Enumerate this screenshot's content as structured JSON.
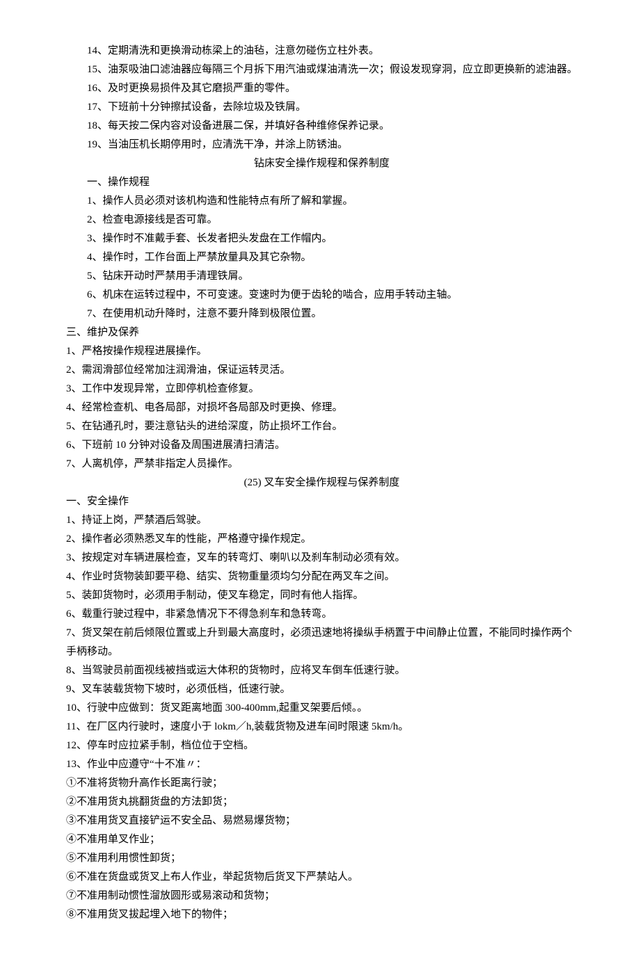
{
  "lines": [
    {
      "cls": "indent",
      "t": "14、定期清洗和更换滑动栋梁上的油毡，注意勿碰伤立柱外表。"
    },
    {
      "cls": "indent",
      "t": "15、油泵吸油口滤油器应每隔三个月拆下用汽油或煤油清洗一次；假设发现穿洞，应立即更换新的滤油器。"
    },
    {
      "cls": "indent",
      "t": "16、及时更换易损件及其它磨损严重的零件。"
    },
    {
      "cls": "indent",
      "t": "17、下班前十分钟擦拭设备，去除垃圾及铁屑。"
    },
    {
      "cls": "indent",
      "t": "18、每天按二保内容对设备进展二保，并填好各种维修保养记录。"
    },
    {
      "cls": "indent",
      "t": "19、当油压机长期停用时，应清洗干净，并涂上防锈油。"
    },
    {
      "cls": "center",
      "t": "钻床安全操作规程和保养制度"
    },
    {
      "cls": "indent",
      "t": "一、操作规程"
    },
    {
      "cls": "indent",
      "t": "1、操作人员必须对该机构造和性能特点有所了解和掌握。"
    },
    {
      "cls": "indent",
      "t": "2、检查电源接线是否可靠。"
    },
    {
      "cls": "indent",
      "t": "3、操作时不准戴手套、长发者把头发盘在工作帽内。"
    },
    {
      "cls": "indent",
      "t": "4、操作时，工作台面上严禁放量具及其它杂物。"
    },
    {
      "cls": "indent",
      "t": "5、钻床开动时严禁用手清理铁屑。"
    },
    {
      "cls": "indent",
      "t": "6、机床在运转过程中，不可变速。变速时为便于齿轮的啮合，应用手转动主轴。"
    },
    {
      "cls": "indent",
      "t": "7、在使用机动升降时，注意不要升降到极限位置。"
    },
    {
      "cls": "",
      "t": "三、维护及保养"
    },
    {
      "cls": "",
      "t": "1、严格按操作规程进展操作。"
    },
    {
      "cls": "",
      "t": "2、需润滑部位经常加注润滑油，保证运转灵活。"
    },
    {
      "cls": "",
      "t": "3、工作中发现异常，立即停机检查修复。"
    },
    {
      "cls": "",
      "t": "4、经常检查机、电各局部，对损坏各局部及时更换、修理。"
    },
    {
      "cls": "",
      "t": "5、在钻通孔时，要注意钻头的进给深度，防止损坏工作台。"
    },
    {
      "cls": "",
      "t": "6、下班前 10 分钟对设备及周围进展清扫清洁。"
    },
    {
      "cls": "",
      "t": "7、人离机停，严禁非指定人员操作。"
    },
    {
      "cls": "center",
      "t": "(25) 叉车安全操作规程与保养制度"
    },
    {
      "cls": "",
      "t": "一、安全操作"
    },
    {
      "cls": "",
      "t": "1、持证上岗，严禁酒后驾驶。"
    },
    {
      "cls": "",
      "t": "2、操作者必须熟悉叉车的性能，严格遵守操作规定。"
    },
    {
      "cls": "",
      "t": "3、按规定对车辆进展检查，叉车的转弯灯、喇叭以及刹车制动必须有效。"
    },
    {
      "cls": "",
      "t": "4、作业时货物装卸要平稳、结实、货物重量须均匀分配在两叉车之间。"
    },
    {
      "cls": "",
      "t": "5、装卸货物时，必须用手制动，使叉车稳定，同时有他人指挥。"
    },
    {
      "cls": "",
      "t": "6、载重行驶过程中，非紧急情况下不得急刹车和急转弯。"
    },
    {
      "cls": "",
      "t": "7、货叉架在前后倾限位置或上升到最大高度时，必须迅速地将操纵手柄置于中间静止位置，不能同时操作两个手柄移动。"
    },
    {
      "cls": "",
      "t": "8、当驾驶员前面视线被挡或运大体积的货物时，应将叉车倒车低速行驶。"
    },
    {
      "cls": "",
      "t": "9、叉车装载货物下坡时，必须低档，低速行驶。"
    },
    {
      "cls": "",
      "t": "10、行驶中应做到：货叉距离地面 300-400mm,起重叉架要后倾。。"
    },
    {
      "cls": "",
      "t": "11、在厂区内行驶时，速度小于 lokm／h,装载货物及进车间时限速 5km/h。"
    },
    {
      "cls": "",
      "t": "12、停车时应拉紧手制，档位位于空档。"
    },
    {
      "cls": "",
      "t": "13、作业中应遵守“十不准〃："
    },
    {
      "cls": "",
      "t": "①不准将货物升高作长距离行驶；"
    },
    {
      "cls": "",
      "t": "②不准用货丸挑翻货盘的方法卸货；"
    },
    {
      "cls": "",
      "t": "③不准用货叉直接铲运不安全品、易燃易爆货物；"
    },
    {
      "cls": "",
      "t": "④不准用单叉作业；"
    },
    {
      "cls": "",
      "t": "⑤不准用利用惯性卸货；"
    },
    {
      "cls": "",
      "t": "⑥不准在货盘或货叉上布人作业，举起货物后货叉下严禁站人。"
    },
    {
      "cls": "",
      "t": "⑦不准用制动惯性溜放圆形或易滚动和货物；"
    },
    {
      "cls": "",
      "t": "⑧不准用货叉拔起埋入地下的物件；"
    }
  ]
}
